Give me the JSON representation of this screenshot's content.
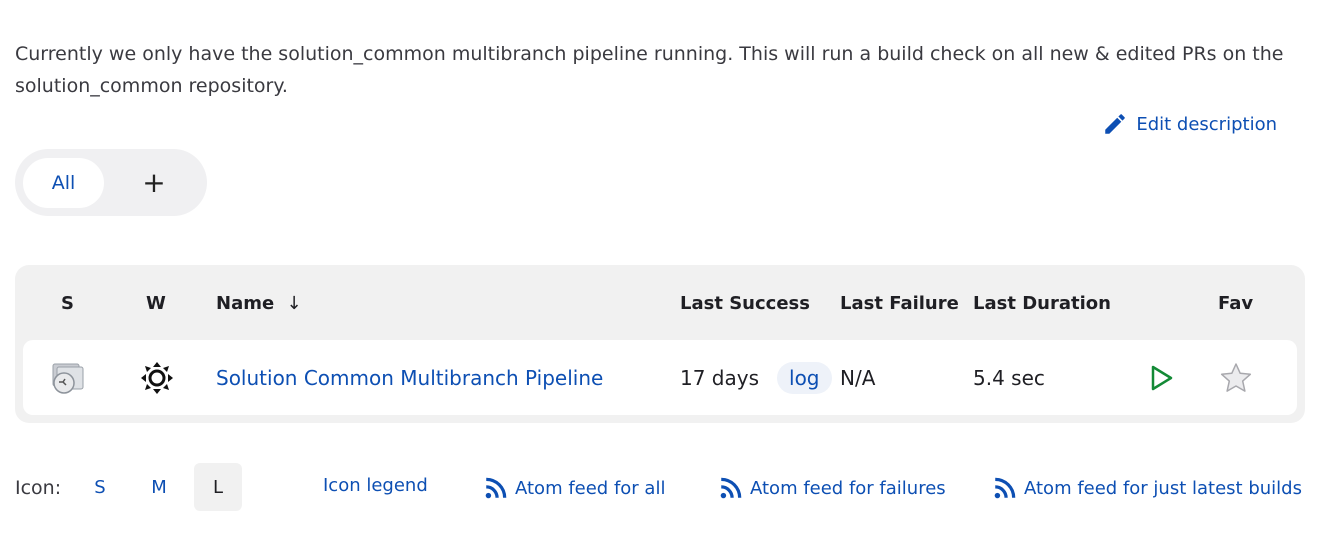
{
  "description": {
    "text": "Currently we only have the solution_common multibranch pipeline running. This will run a build check on all new & edited PRs on the solution_common repository.",
    "edit_label": "Edit description"
  },
  "view_tabs": {
    "all_label": "All",
    "add_label": "+"
  },
  "table": {
    "columns": {
      "s": "S",
      "w": "W",
      "name": "Name",
      "name_sort": "↓",
      "last_success": "Last Success",
      "last_failure": "Last Failure",
      "last_duration": "Last Duration",
      "fav": "Fav"
    },
    "rows": [
      {
        "status_icon": "folder-pipeline-icon",
        "weather_icon": "sun-weather-icon",
        "name": "Solution Common Multibranch Pipeline",
        "last_success": "17 days",
        "log_label": "log",
        "last_failure": "N/A",
        "last_duration": "5.4 sec",
        "build_icon": "play-icon",
        "fav_icon": "star-icon"
      }
    ]
  },
  "footer": {
    "icon_label": "Icon:",
    "sizes": [
      "S",
      "M",
      "L"
    ],
    "active_size": "L",
    "icon_legend": "Icon legend",
    "feed_all": "Atom feed for all",
    "feed_failures": "Atom feed for failures",
    "feed_latest": "Atom feed for just latest builds"
  },
  "colors": {
    "link": "#0d4fb3",
    "play": "#138a36",
    "panel": "#f1f1f1"
  }
}
